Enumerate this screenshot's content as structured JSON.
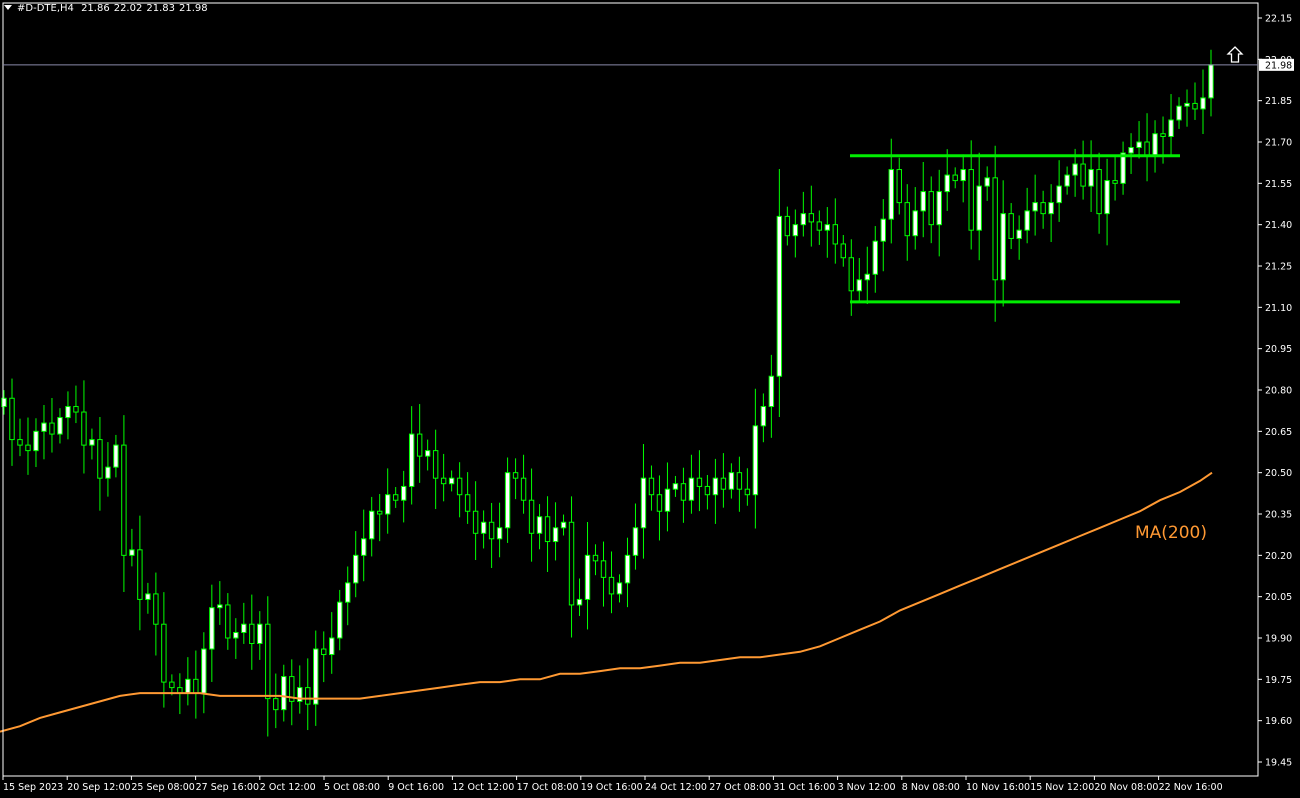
{
  "header": {
    "symbol": "#D-DTE,H4",
    "open": "21.86",
    "high": "22.02",
    "low": "21.83",
    "close": "21.98"
  },
  "chart_data": {
    "type": "candlestick",
    "symbol": "#D-DTE",
    "timeframe": "H4",
    "y_ticks": [
      "22.15",
      "22.00",
      "21.85",
      "21.70",
      "21.55",
      "21.40",
      "21.25",
      "21.10",
      "20.95",
      "20.80",
      "20.65",
      "20.50",
      "20.35",
      "20.20",
      "20.05",
      "19.90",
      "19.75",
      "19.60",
      "19.45"
    ],
    "ylim": [
      19.4,
      22.2
    ],
    "x_ticks": [
      "15 Sep 2023",
      "20 Sep 12:00",
      "25 Sep 08:00",
      "27 Sep 16:00",
      "2 Oct 12:00",
      "5 Oct 08:00",
      "9 Oct 16:00",
      "12 Oct 12:00",
      "17 Oct 08:00",
      "19 Oct 16:00",
      "24 Oct 12:00",
      "27 Oct 08:00",
      "31 Oct 16:00",
      "3 Nov 12:00",
      "8 Nov 08:00",
      "10 Nov 16:00",
      "15 Nov 12:00",
      "20 Nov 08:00",
      "22 Nov 16:00"
    ],
    "current_price": "21.98",
    "current_price_value": 21.98,
    "bull_color": "#ffffff",
    "bear_color": "#000000",
    "wick_color": "#00ff00",
    "closes": [
      20.77,
      20.62,
      20.6,
      20.58,
      20.65,
      20.68,
      20.64,
      20.7,
      20.74,
      20.72,
      20.6,
      20.62,
      20.48,
      20.52,
      20.6,
      20.2,
      20.22,
      20.04,
      20.06,
      19.95,
      19.74,
      19.72,
      19.7,
      19.75,
      19.7,
      19.86,
      20.01,
      20.02,
      19.9,
      19.92,
      19.95,
      19.88,
      19.95,
      19.68,
      19.64,
      19.76,
      19.67,
      19.72,
      19.66,
      19.86,
      19.84,
      19.9,
      20.03,
      20.1,
      20.2,
      20.26,
      20.36,
      20.35,
      20.42,
      20.4,
      20.45,
      20.64,
      20.56,
      20.58,
      20.48,
      20.46,
      20.48,
      20.42,
      20.36,
      20.28,
      20.32,
      20.26,
      20.3,
      20.5,
      20.48,
      20.4,
      20.28,
      20.34,
      20.25,
      20.3,
      20.32,
      20.02,
      20.04,
      20.2,
      20.18,
      20.12,
      20.06,
      20.1,
      20.2,
      20.3,
      20.48,
      20.42,
      20.36,
      20.44,
      20.46,
      20.4,
      20.48,
      20.45,
      20.42,
      20.48,
      20.44,
      20.5,
      20.44,
      20.42,
      20.67,
      20.74,
      20.85,
      21.43,
      21.36,
      21.4,
      21.44,
      21.41,
      21.38,
      21.4,
      21.33,
      21.28,
      21.16,
      21.2,
      21.22,
      21.34,
      21.42,
      21.6,
      21.48,
      21.36,
      21.45,
      21.52,
      21.4,
      21.52,
      21.58,
      21.56,
      21.6,
      21.38,
      21.54,
      21.57,
      21.2,
      21.44,
      21.35,
      21.38,
      21.45,
      21.48,
      21.44,
      21.48,
      21.54,
      21.58,
      21.62,
      21.54,
      21.6,
      21.44,
      21.56,
      21.55,
      21.66,
      21.68,
      21.7,
      21.65,
      21.73,
      21.72,
      21.78,
      21.83,
      21.84,
      21.82,
      21.86,
      21.98
    ]
  },
  "ma_label": "MA(200)",
  "ma_color": "#ff9933",
  "ma_points": [
    [
      0,
      19.56
    ],
    [
      20,
      19.58
    ],
    [
      40,
      19.61
    ],
    [
      60,
      19.63
    ],
    [
      80,
      19.65
    ],
    [
      100,
      19.67
    ],
    [
      120,
      19.69
    ],
    [
      140,
      19.7
    ],
    [
      160,
      19.7
    ],
    [
      180,
      19.7
    ],
    [
      200,
      19.7
    ],
    [
      220,
      19.69
    ],
    [
      240,
      19.69
    ],
    [
      260,
      19.69
    ],
    [
      280,
      19.69
    ],
    [
      300,
      19.68
    ],
    [
      320,
      19.68
    ],
    [
      340,
      19.68
    ],
    [
      360,
      19.68
    ],
    [
      380,
      19.69
    ],
    [
      400,
      19.7
    ],
    [
      420,
      19.71
    ],
    [
      440,
      19.72
    ],
    [
      460,
      19.73
    ],
    [
      480,
      19.74
    ],
    [
      500,
      19.74
    ],
    [
      520,
      19.75
    ],
    [
      540,
      19.75
    ],
    [
      560,
      19.77
    ],
    [
      580,
      19.77
    ],
    [
      600,
      19.78
    ],
    [
      620,
      19.79
    ],
    [
      640,
      19.79
    ],
    [
      660,
      19.8
    ],
    [
      680,
      19.81
    ],
    [
      700,
      19.81
    ],
    [
      720,
      19.82
    ],
    [
      740,
      19.83
    ],
    [
      760,
      19.83
    ],
    [
      780,
      19.84
    ],
    [
      800,
      19.85
    ],
    [
      820,
      19.87
    ],
    [
      840,
      19.9
    ],
    [
      860,
      19.93
    ],
    [
      880,
      19.96
    ],
    [
      900,
      20.0
    ],
    [
      920,
      20.03
    ],
    [
      940,
      20.06
    ],
    [
      960,
      20.09
    ],
    [
      980,
      20.12
    ],
    [
      1000,
      20.15
    ],
    [
      1020,
      20.18
    ],
    [
      1040,
      20.21
    ],
    [
      1060,
      20.24
    ],
    [
      1080,
      20.27
    ],
    [
      1100,
      20.3
    ],
    [
      1120,
      20.33
    ],
    [
      1140,
      20.36
    ],
    [
      1160,
      20.4
    ],
    [
      1180,
      20.43
    ],
    [
      1200,
      20.47
    ],
    [
      1212,
      20.5
    ]
  ],
  "levels": [
    {
      "name": "resistance",
      "color": "#00ee00",
      "x1": 850,
      "x2": 1180,
      "price": 21.65
    },
    {
      "name": "support",
      "color": "#00ee00",
      "x1": 850,
      "x2": 1180,
      "price": 21.12
    }
  ]
}
